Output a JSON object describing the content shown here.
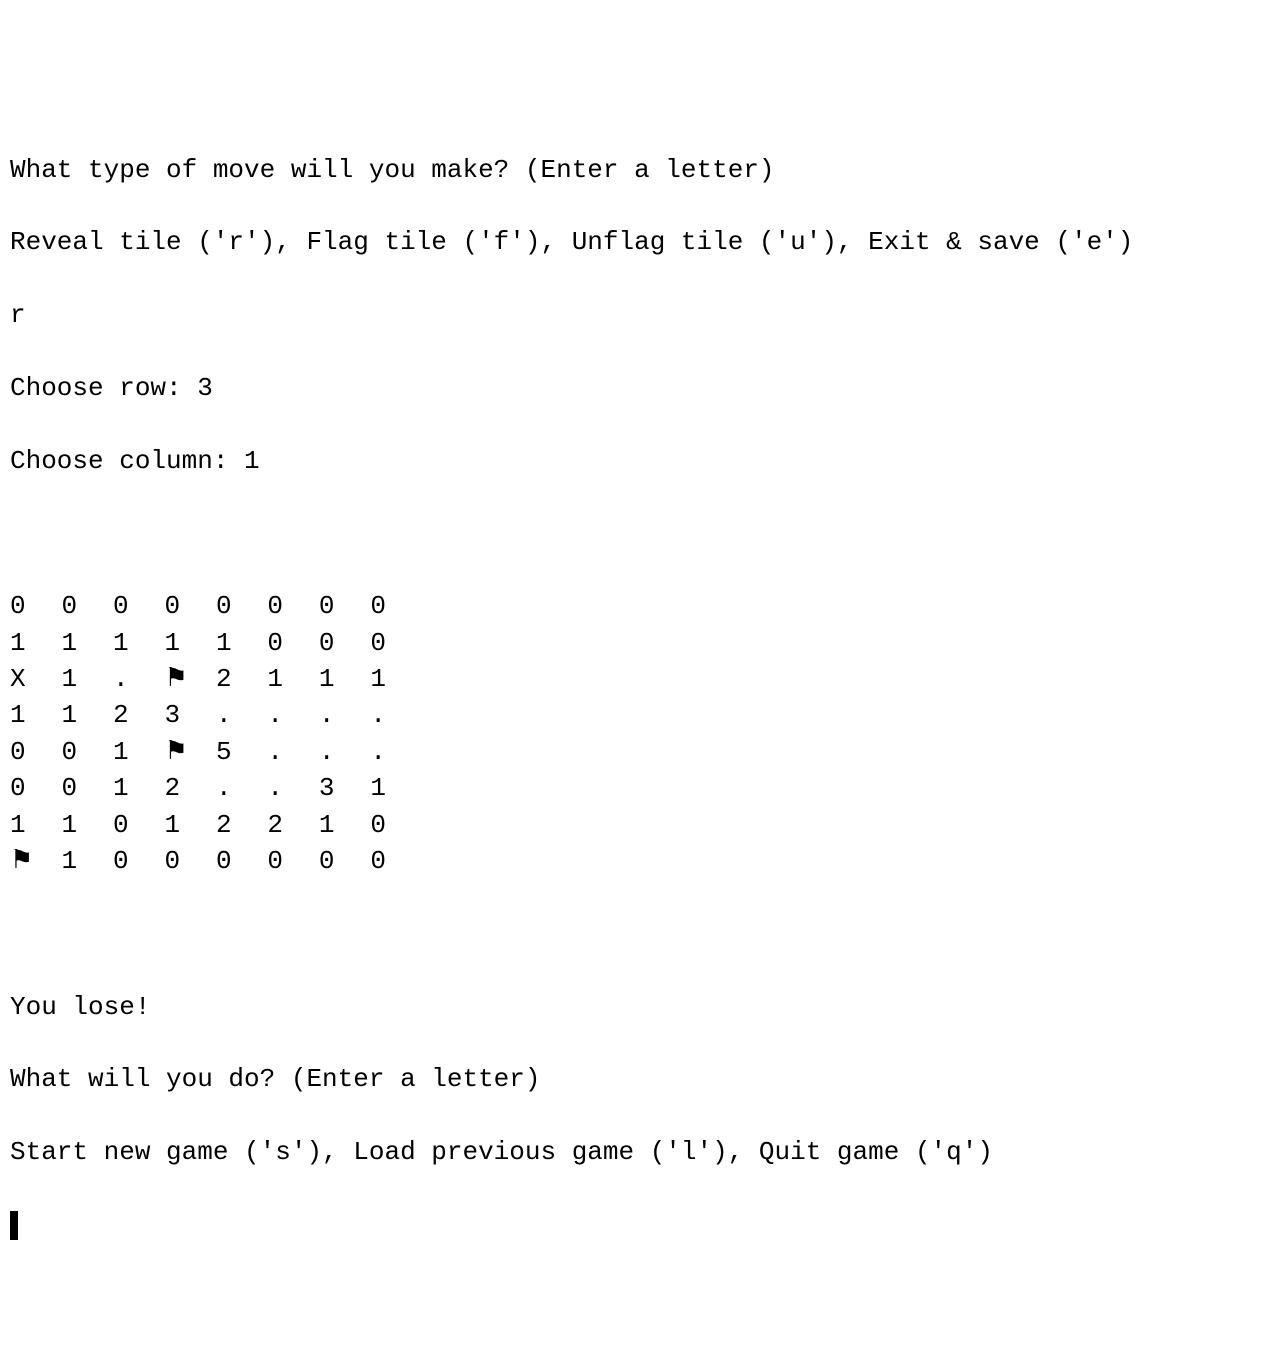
{
  "prompts": {
    "move_type_question": "What type of move will you make? (Enter a letter)",
    "move_options": "Reveal tile ('r'), Flag tile ('f'), Unflag tile ('u'), Exit & save ('e')",
    "choose_row_label": "Choose row: ",
    "choose_column_label": "Choose column: ",
    "result_message": "You lose!",
    "next_action_question": "What will you do? (Enter a letter)",
    "next_action_options": "Start new game ('s'), Load previous game ('l'), Quit game ('q')"
  },
  "inputs": {
    "move_choice": "r",
    "row_choice": "3",
    "column_choice": "1"
  },
  "board": {
    "rows": [
      [
        "0",
        "0",
        "0",
        "0",
        "0",
        "0",
        "0",
        "0"
      ],
      [
        "1",
        "1",
        "1",
        "1",
        "1",
        "0",
        "0",
        "0"
      ],
      [
        "X",
        "1",
        ".",
        "⚑",
        "2",
        "1",
        "1",
        "1"
      ],
      [
        "1",
        "1",
        "2",
        "3",
        ".",
        ".",
        ".",
        "."
      ],
      [
        "0",
        "0",
        "1",
        "⚑",
        "5",
        ".",
        ".",
        "."
      ],
      [
        "0",
        "0",
        "1",
        "2",
        ".",
        ".",
        "3",
        "1"
      ],
      [
        "1",
        "1",
        "0",
        "1",
        "2",
        "2",
        "1",
        "0"
      ],
      [
        "⚑",
        "1",
        "0",
        "0",
        "0",
        "0",
        "0",
        "0"
      ]
    ]
  }
}
